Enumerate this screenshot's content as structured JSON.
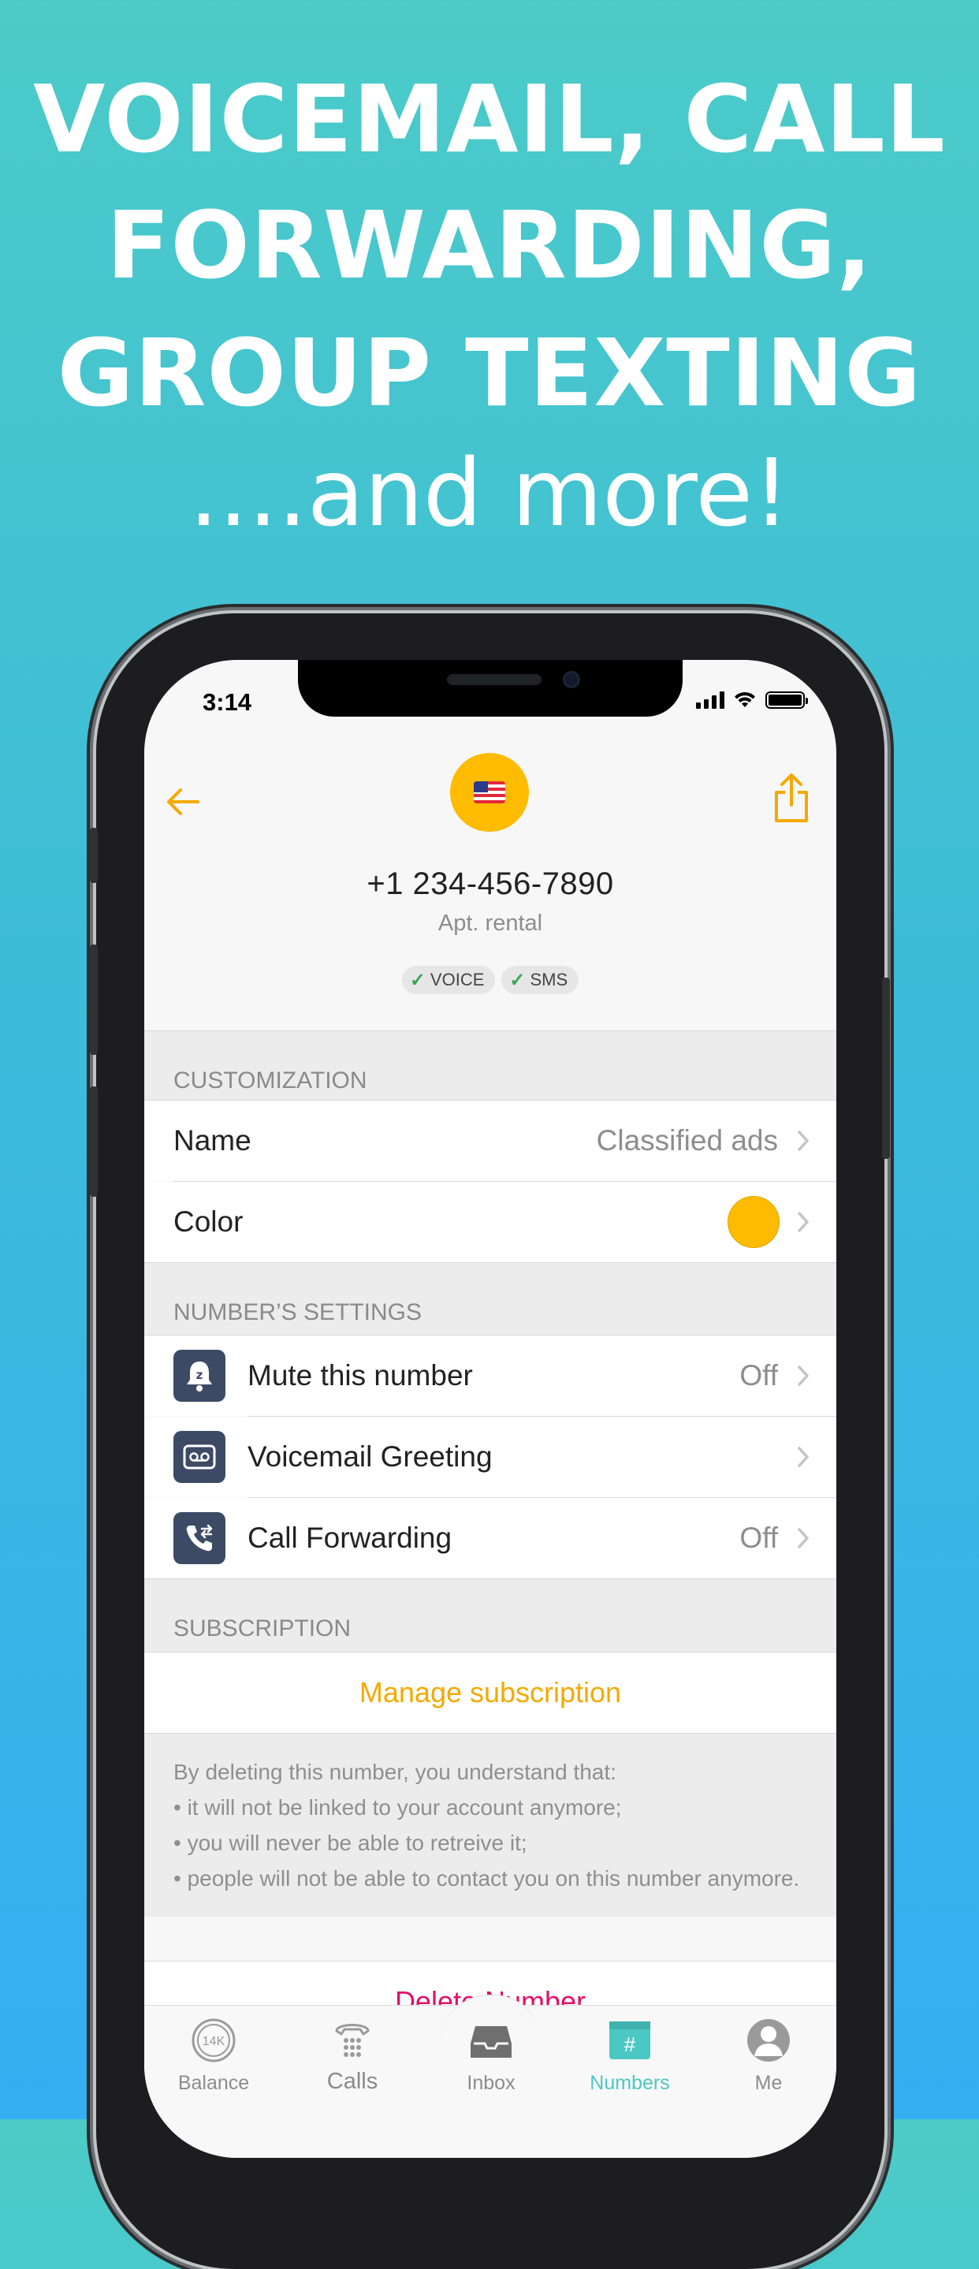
{
  "promo": {
    "line1": "VOICEMAIL, CALL",
    "line2": "FORWARDING,",
    "line3": "GROUP TEXTING",
    "line4": "....and more!"
  },
  "status_bar": {
    "time": "3:14"
  },
  "number_header": {
    "phone_number": "+1 234-456-7890",
    "label": "Apt. rental",
    "capabilities": [
      "VOICE",
      "SMS"
    ]
  },
  "customization": {
    "header": "CUSTOMIZATION",
    "name_label": "Name",
    "name_value": "Classified ads",
    "color_label": "Color",
    "color_value": "#ffbb00"
  },
  "number_settings": {
    "header": "NUMBER’S SETTINGS",
    "mute_label": "Mute this number",
    "mute_value": "Off",
    "voicemail_label": "Voicemail Greeting",
    "forwarding_label": "Call Forwarding",
    "forwarding_value": "Off"
  },
  "subscription": {
    "header": "SUBSCRIPTION",
    "manage_label": "Manage subscription"
  },
  "disclaimer": {
    "intro": "By deleting this number, you understand that:",
    "items": [
      "• it will not be linked to your account anymore;",
      "• you will never be able to retreive it;",
      "• people will not be able to contact you on this number anymore."
    ]
  },
  "delete_label": "Delete Number",
  "tabbar": {
    "balance": "Balance",
    "balance_badge": "14K",
    "calls": "Calls",
    "inbox": "Inbox",
    "numbers": "Numbers",
    "numbers_badge": "#",
    "me": "Me"
  },
  "colors": {
    "accent": "#ffbb00",
    "active_tab": "#4cc8c4",
    "danger": "#e0106a",
    "icon_bg": "#3d4a66"
  }
}
